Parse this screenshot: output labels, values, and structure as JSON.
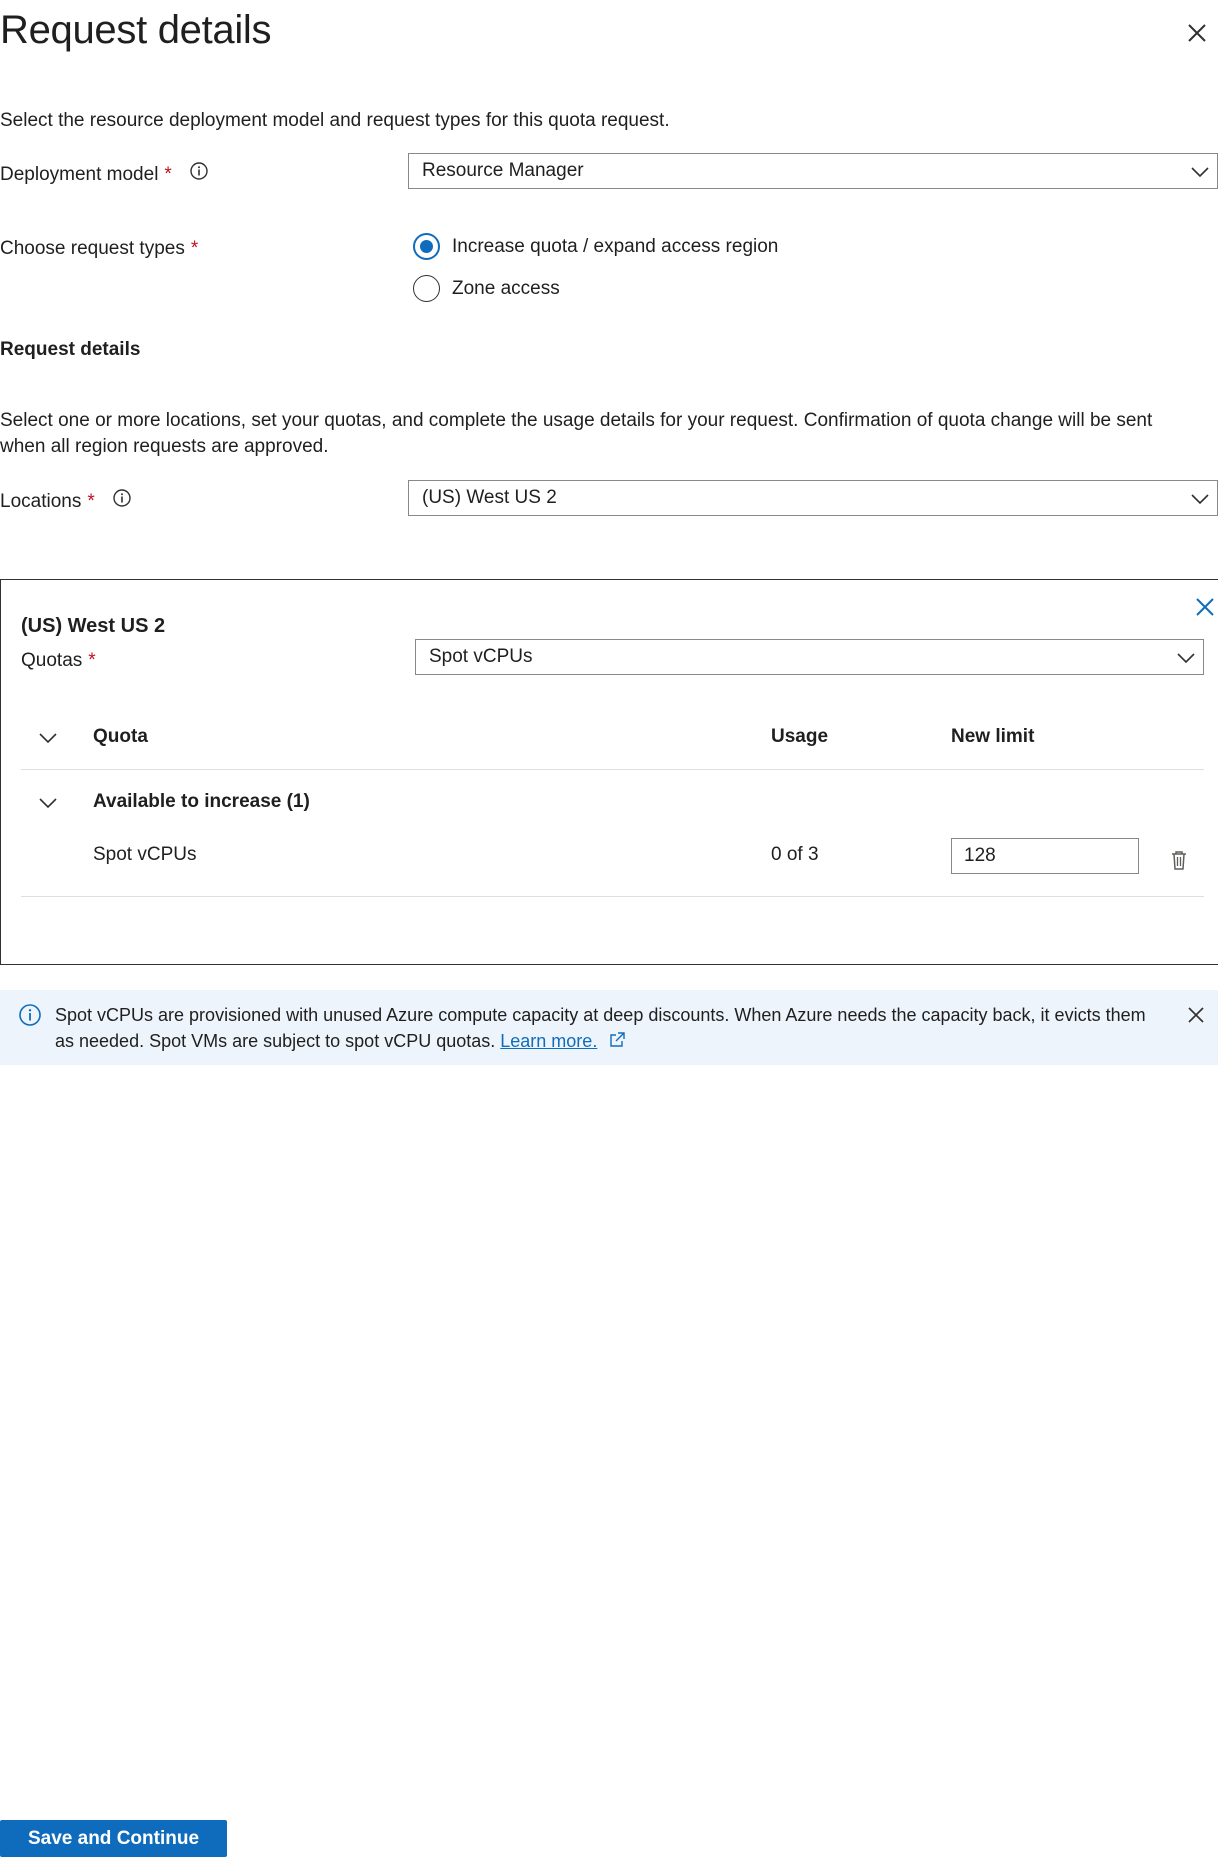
{
  "header": {
    "title": "Request details"
  },
  "intro": {
    "text": "Select the resource deployment model and request types for this quota request."
  },
  "deployment_model": {
    "label": "Deployment model",
    "required_mark": "*",
    "value": "Resource Manager"
  },
  "request_types": {
    "label": "Choose request types",
    "required_mark": "*",
    "options": [
      {
        "label": "Increase quota / expand access region",
        "selected": true
      },
      {
        "label": "Zone access",
        "selected": false
      }
    ]
  },
  "details_section": {
    "heading": "Request details",
    "description": "Select one or more locations, set your quotas, and complete the usage details for your request. Confirmation of quota change will be sent when all region requests are approved."
  },
  "locations": {
    "label": "Locations",
    "required_mark": "*",
    "value": "(US) West US 2"
  },
  "region_card": {
    "title": "(US) West US 2",
    "quotas_label": "Quotas",
    "required_mark": "*",
    "quotas_value": "Spot vCPUs",
    "table": {
      "headers": {
        "quota": "Quota",
        "usage": "Usage",
        "new_limit": "New limit"
      },
      "group": {
        "label": "Available to increase (1)"
      },
      "rows": [
        {
          "quota": "Spot vCPUs",
          "usage": "0 of 3",
          "new_limit": "128"
        }
      ]
    }
  },
  "banner": {
    "text": "Spot vCPUs are provisioned with unused Azure compute capacity at deep discounts. When Azure needs the capacity back, it evicts them as needed. Spot VMs are subject to spot vCPU quotas.",
    "link": "Learn more."
  },
  "footer": {
    "primary_button": "Save and Continue"
  },
  "colors": {
    "accent": "#0f6cbd",
    "required": "#c50f1f",
    "banner_bg": "#eef4fb"
  }
}
